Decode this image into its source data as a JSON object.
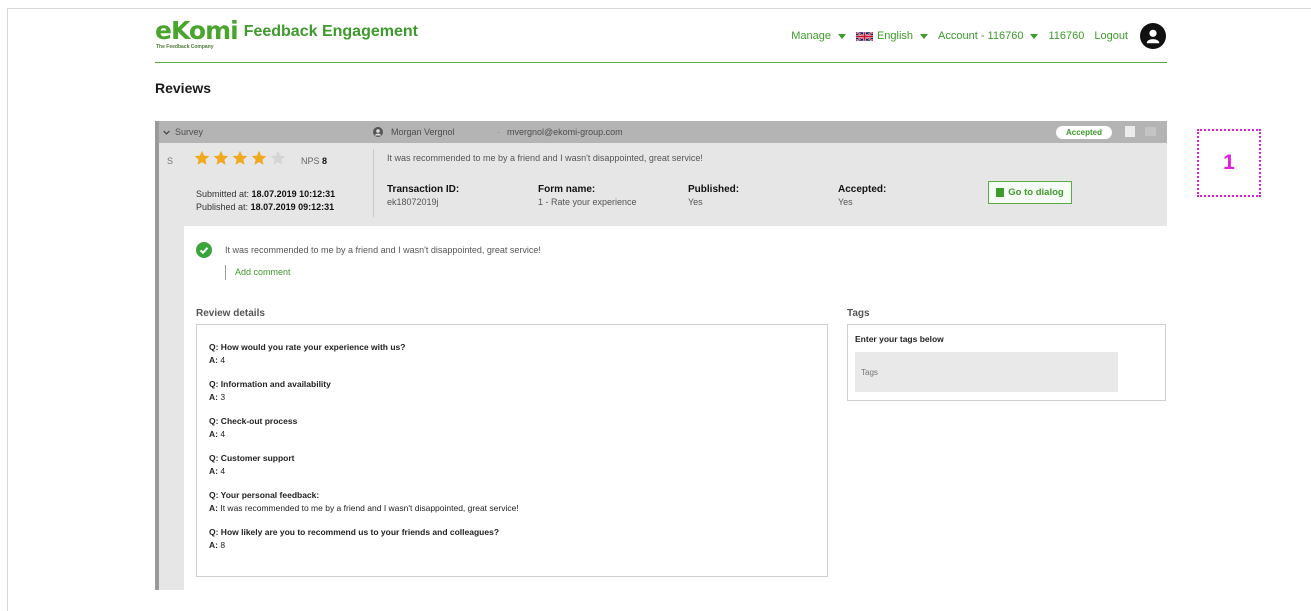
{
  "brand": {
    "logo_text": "eKomi",
    "tagline": "The Feedback Company",
    "title": "Feedback Engagement",
    "accent_color": "#3d9a2c"
  },
  "topnav": {
    "manage": "Manage",
    "language": "English",
    "account": "Account - 116760",
    "account_id": "116760",
    "logout": "Logout"
  },
  "page": {
    "title": "Reviews"
  },
  "review": {
    "type_label": "Survey",
    "customer_name": "Morgan Vergnol",
    "customer_email": "mvergnol@ekomi-group.com",
    "status_badge": "Accepted",
    "row_letter": "S",
    "rating": 4,
    "rating_max": 5,
    "nps_label": "NPS",
    "nps_value": "8",
    "comment": "It was recommended to me by a friend and I wasn't disappointed, great service!",
    "submitted_label": "Submitted at:",
    "submitted_value": "18.07.2019 10:12:31",
    "published_at_label": "Published at:",
    "published_at_value": "18.07.2019 09:12:31",
    "transaction_label": "Transaction ID:",
    "transaction_value": "ek18072019j",
    "form_label": "Form name:",
    "form_value": "1 - Rate your experience",
    "published_label": "Published:",
    "published_value": "Yes",
    "accepted_label": "Accepted:",
    "accepted_value": "Yes",
    "goto_button": "Go to dialog",
    "add_comment": "Add comment"
  },
  "details": {
    "title": "Review details",
    "q_prefix": "Q:",
    "a_prefix": "A:",
    "items": [
      {
        "q": "How would you rate your experience with us?",
        "a": "4"
      },
      {
        "q": "Information and availability",
        "a": "3"
      },
      {
        "q": "Check-out process",
        "a": "4"
      },
      {
        "q": "Customer support",
        "a": "4"
      },
      {
        "q": "Your personal feedback:",
        "a": "It was recommended to me by a friend and I wasn't disappointed, great service!"
      },
      {
        "q": "How likely are you to recommend us to your friends and colleagues?",
        "a": "8"
      }
    ]
  },
  "tags": {
    "title": "Tags",
    "label": "Enter your tags below",
    "placeholder": "Tags"
  },
  "annotation": {
    "marker": "1"
  }
}
